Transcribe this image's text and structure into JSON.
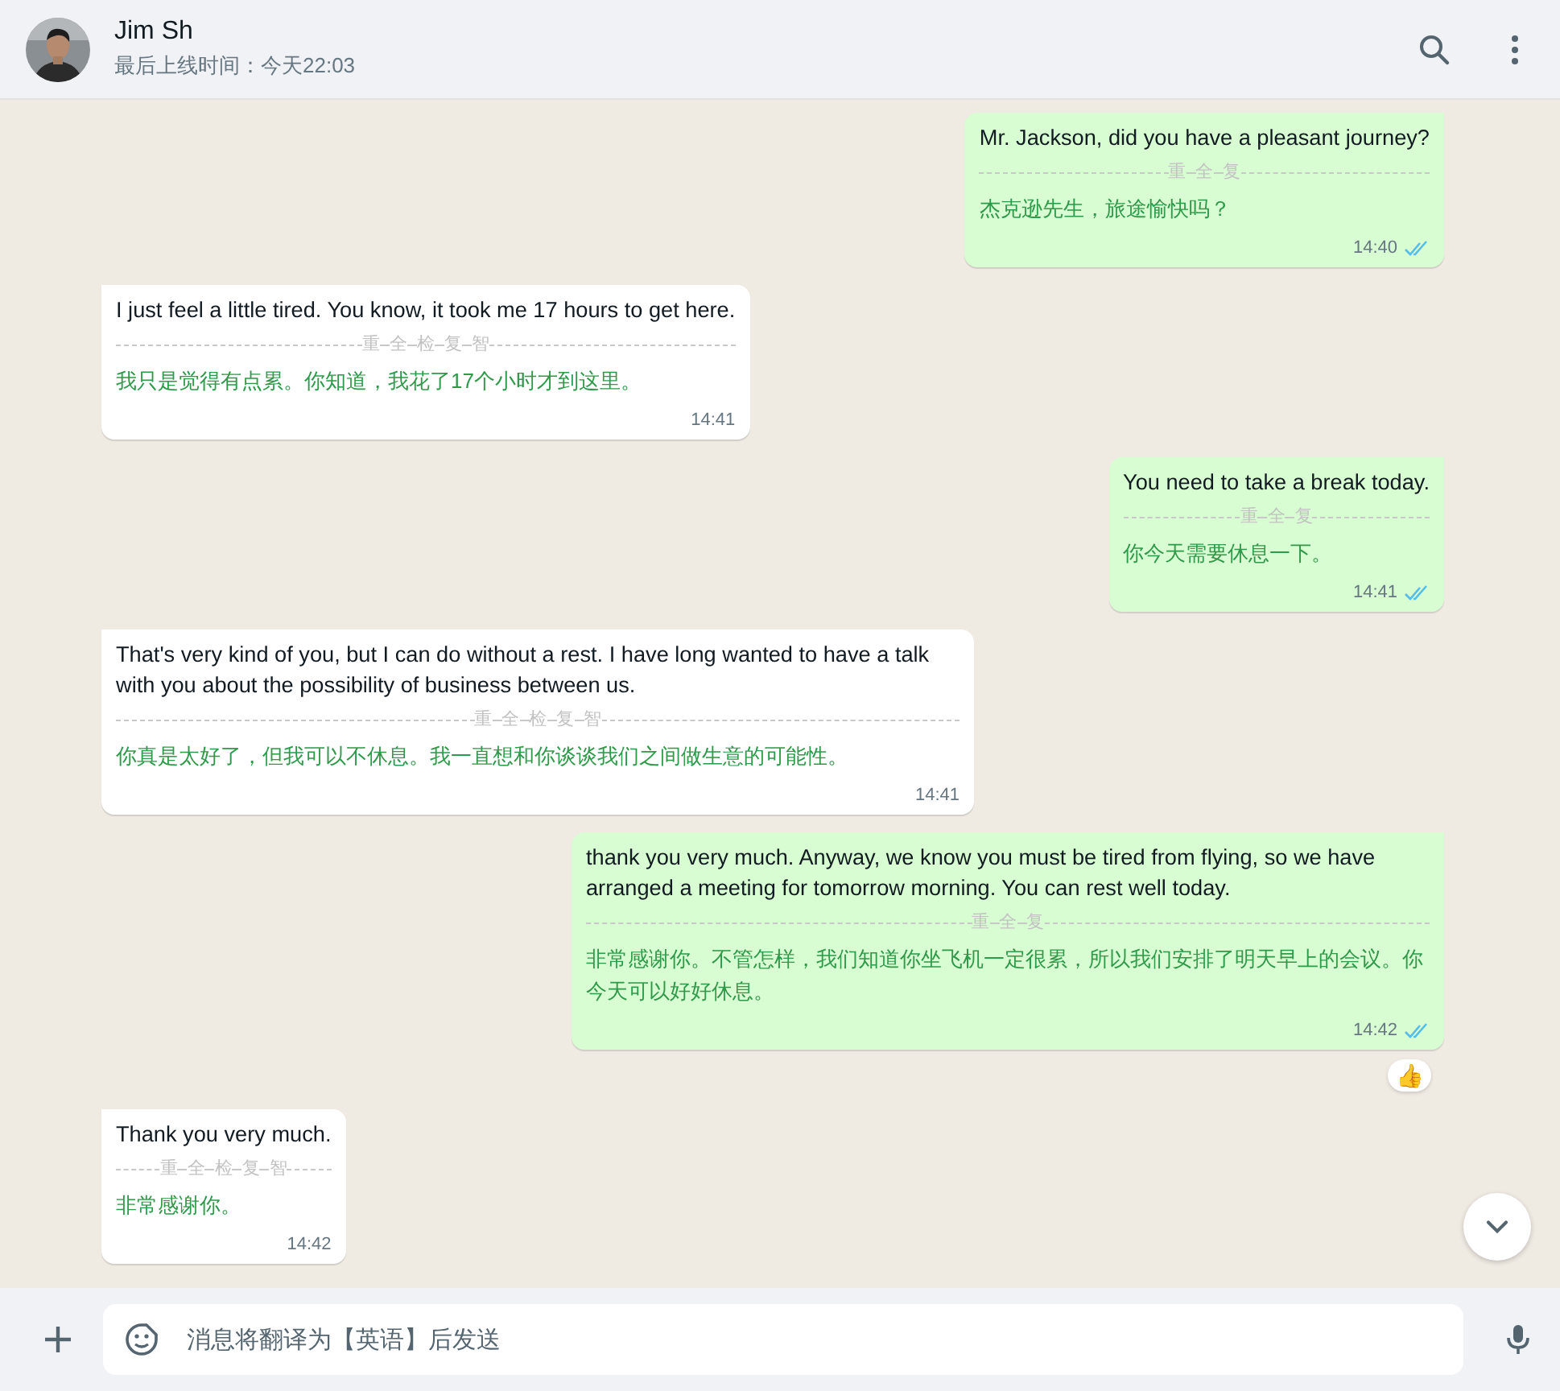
{
  "contact": {
    "name": "Jim Sh",
    "status": "最后上线时间：今天22:03"
  },
  "messages": [
    {
      "outgoing": true,
      "text": "Mr. Jackson, did you have a pleasant journey?",
      "actions": [
        "重",
        "全",
        "复"
      ],
      "translation": "杰克逊先生，旅途愉快吗？",
      "time": "14:40",
      "read": true
    },
    {
      "outgoing": false,
      "text": "I just feel a little tired. You know, it took me 17 hours to get here.",
      "actions": [
        "重",
        "全",
        "检",
        "复",
        "智"
      ],
      "translation": "我只是觉得有点累。你知道，我花了17个小时才到这里。",
      "time": "14:41"
    },
    {
      "outgoing": true,
      "text": "You need to take a break today.",
      "actions": [
        "重",
        "全",
        "复"
      ],
      "translation": "你今天需要休息一下。",
      "time": "14:41",
      "read": true
    },
    {
      "outgoing": false,
      "text": "That's very kind of you, but I can do without a rest. I have long wanted to have a talk with you about the possibility of business between us.",
      "actions": [
        "重",
        "全",
        "检",
        "复",
        "智"
      ],
      "translation": "你真是太好了，但我可以不休息。我一直想和你谈谈我们之间做生意的可能性。",
      "time": "14:41"
    },
    {
      "outgoing": true,
      "text": "thank you very much. Anyway, we know you must be tired from flying, so we have arranged a meeting for tomorrow morning. You can rest well today.",
      "actions": [
        "重",
        "全",
        "复"
      ],
      "translation": "非常感谢你。不管怎样，我们知道你坐飞机一定很累，所以我们安排了明天早上的会议。你今天可以好好休息。",
      "time": "14:42",
      "read": true,
      "reaction": "👍"
    },
    {
      "outgoing": false,
      "text": "Thank you very much.",
      "actions": [
        "重",
        "全",
        "检",
        "复",
        "智"
      ],
      "translation": "非常感谢你。",
      "time": "14:42"
    }
  ],
  "composer": {
    "placeholder": "消息将翻译为【英语】后发送"
  }
}
